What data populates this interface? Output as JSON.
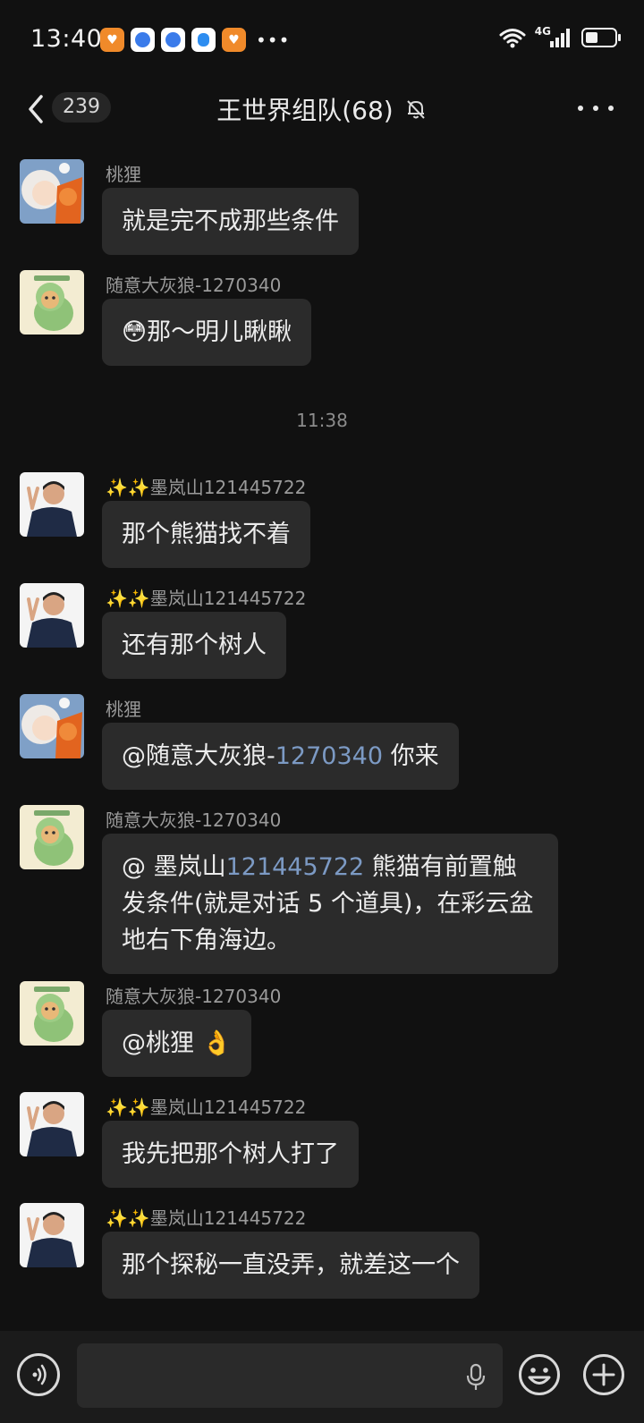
{
  "status_bar": {
    "time": "13:40",
    "network": "4G"
  },
  "header": {
    "unread_count": "239",
    "title": "王世界组队(68)"
  },
  "messages": [
    {
      "sender": "桃狸",
      "text": "就是完不成那些条件",
      "avatar": "fox-girl-avatar"
    },
    {
      "sender": "随意大灰狼-1270340",
      "text": "那～明儿瞅瞅",
      "emoji": "😳",
      "avatar": "dino-dog-avatar"
    },
    {
      "timestamp": "11:38"
    },
    {
      "sender": "✨✨墨岚山121445722",
      "text": "那个熊猫找不着",
      "avatar": "man-peace-avatar"
    },
    {
      "sender": "✨✨墨岚山121445722",
      "text": "还有那个树人",
      "avatar": "man-peace-avatar"
    },
    {
      "sender": "桃狸",
      "text_prefix": "@随意大灰狼-",
      "text_mention_num": "1270340",
      "text_suffix": " 你来",
      "avatar": "fox-girl-avatar"
    },
    {
      "sender": "随意大灰狼-1270340",
      "text_prefix": "@ 墨岚山",
      "text_mention_num": "121445722",
      "text_suffix": " 熊猫有前置触发条件(就是对话 5 个道具)，在彩云盆地右下角海边。",
      "avatar": "dino-dog-avatar"
    },
    {
      "sender": "随意大灰狼-1270340",
      "text": "@桃狸",
      "emoji": "👌",
      "avatar": "dino-dog-avatar"
    },
    {
      "sender": "✨✨墨岚山121445722",
      "text": "我先把那个树人打了",
      "avatar": "man-peace-avatar"
    },
    {
      "sender": "✨✨墨岚山121445722",
      "text": "那个探秘一直没弄，就差这一个",
      "avatar": "man-peace-avatar"
    }
  ],
  "composer": {
    "voice_icon": "voice-icon",
    "mic_icon": "mic-icon",
    "emoji_icon": "emoji-icon",
    "plus_icon": "plus-icon"
  },
  "colors": {
    "background": "#111111",
    "bubble": "#2b2b2b",
    "mention": "#7c9ac4"
  }
}
